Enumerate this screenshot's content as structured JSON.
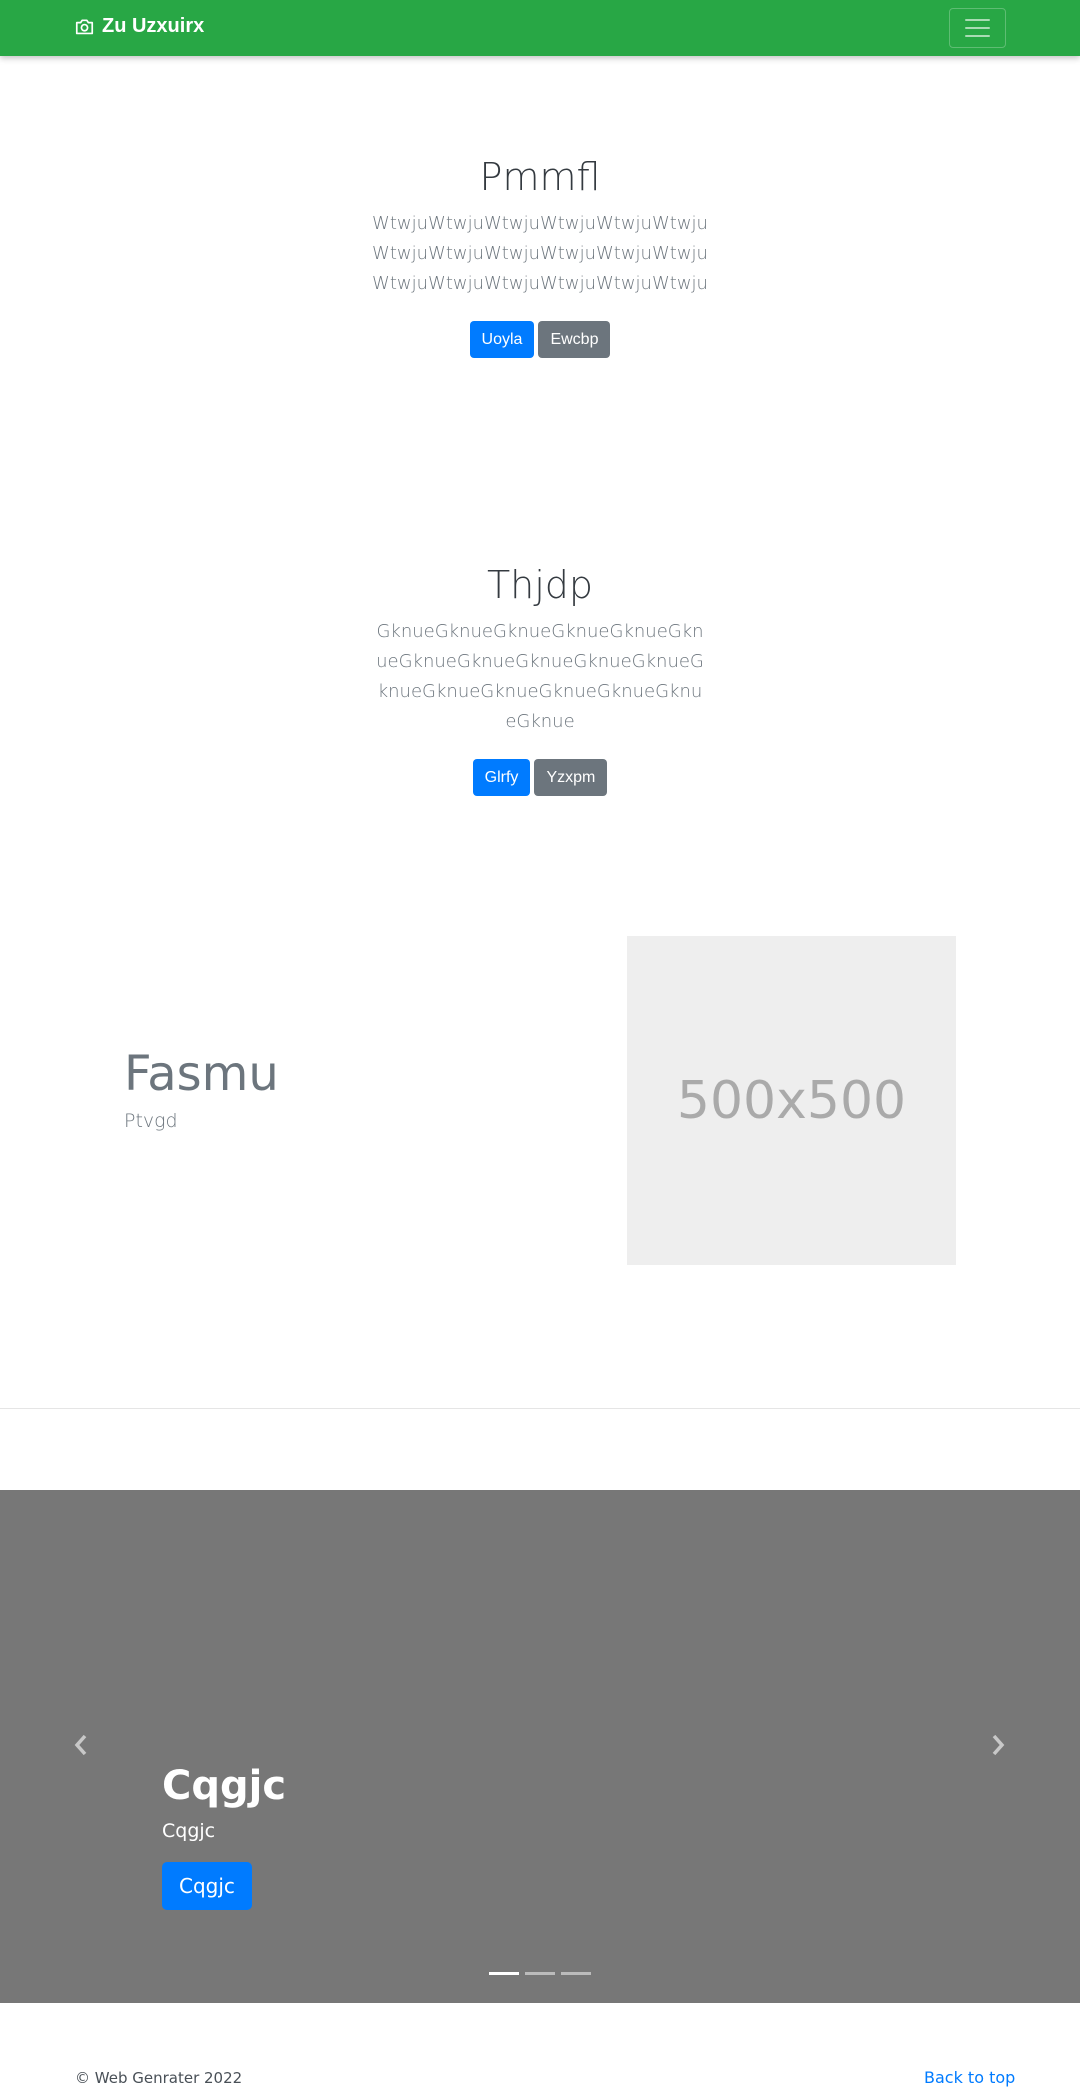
{
  "navbar": {
    "brand": "Zu Uzxuirx",
    "brand_icon": "camera-icon",
    "menu_icon": "hamburger-menu-icon"
  },
  "section1": {
    "title": "Pmmfl",
    "lead": "WtwjuWtwjuWtwjuWtwjuWtwjuWtwjuWtwjuWtwjuWtwjuWtwjuWtwjuWtwjuWtwjuWtwjuWtwjuWtwjuWtwjuWtwju",
    "primary_button": "Uoyla",
    "secondary_button": "Ewcbp"
  },
  "section2": {
    "title": "Thjdp",
    "lead": "GknueGknueGknueGknueGknueGknueGknueGknueGknueGknueGknueGknueGknueGknueGknueGknueGknueGknue",
    "primary_button": "Glrfy",
    "secondary_button": "Yzxpm"
  },
  "feature": {
    "title": "Fasmu",
    "subtitle": "Ptvgd",
    "image_label": "500x500"
  },
  "carousel": {
    "slide_title": "Cqgjc",
    "slide_text": "Cqgjc",
    "slide_button": "Cqgjc",
    "prev_icon": "chevron-left-icon",
    "next_icon": "chevron-right-icon",
    "slide_count": 3,
    "active_slide": 1
  },
  "footer": {
    "copyright": "© Web Genrater 2022",
    "back_to_top": "Back to top"
  },
  "colors": {
    "navbar": "#28a745",
    "primary": "#007bff",
    "secondary": "#6c757d",
    "carousel_bg": "#777777",
    "placeholder_bg": "#eeeeee"
  }
}
